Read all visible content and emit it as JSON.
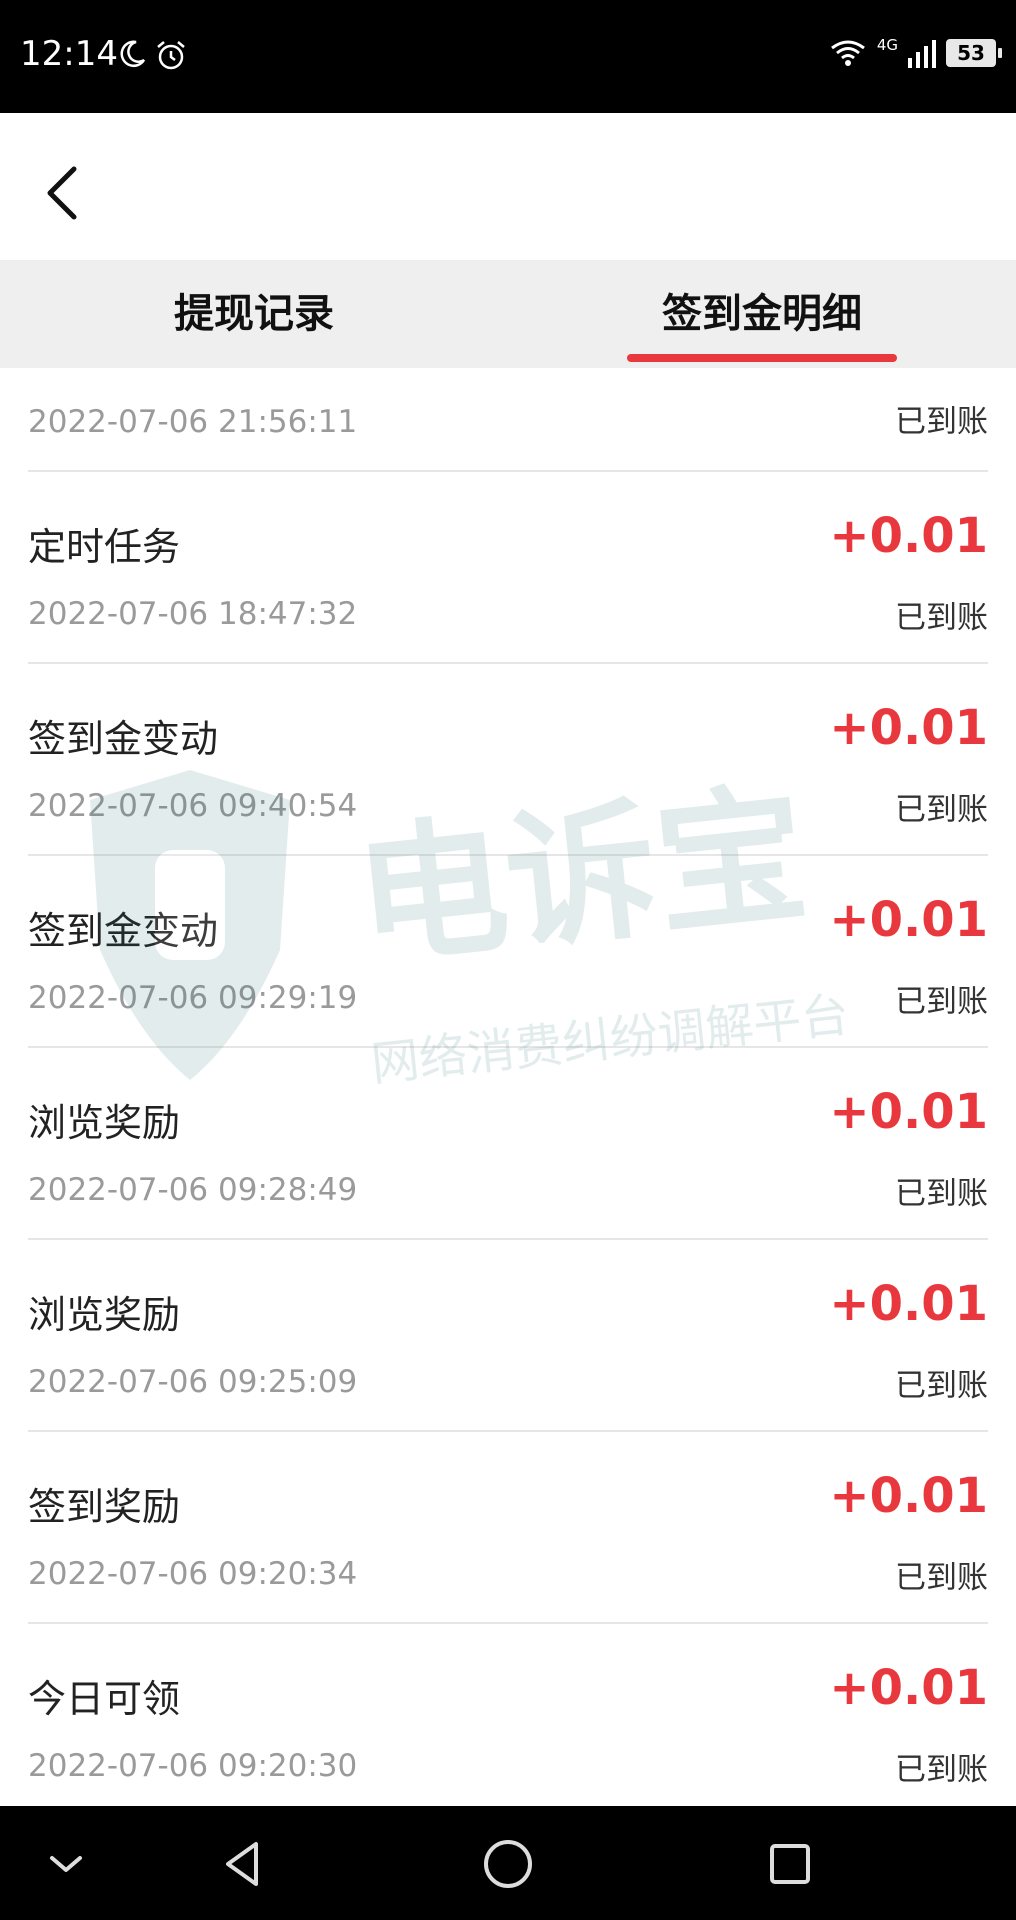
{
  "status_bar": {
    "time": "12:14",
    "battery": "53",
    "network": "4G"
  },
  "tabs": [
    {
      "label": "提现记录",
      "active": false
    },
    {
      "label": "签到金明细",
      "active": true
    }
  ],
  "accent_color": "#e8383d",
  "records": [
    {
      "title": "",
      "time": "2022-07-06 21:56:11",
      "amount": "",
      "status": "已到账"
    },
    {
      "title": "定时任务",
      "time": "2022-07-06 18:47:32",
      "amount": "+0.01",
      "status": "已到账"
    },
    {
      "title": "签到金变动",
      "time": "2022-07-06 09:40:54",
      "amount": "+0.01",
      "status": "已到账"
    },
    {
      "title": "签到金变动",
      "time": "2022-07-06 09:29:19",
      "amount": "+0.01",
      "status": "已到账"
    },
    {
      "title": "浏览奖励",
      "time": "2022-07-06 09:28:49",
      "amount": "+0.01",
      "status": "已到账"
    },
    {
      "title": "浏览奖励",
      "time": "2022-07-06 09:25:09",
      "amount": "+0.01",
      "status": "已到账"
    },
    {
      "title": "签到奖励",
      "time": "2022-07-06 09:20:34",
      "amount": "+0.01",
      "status": "已到账"
    },
    {
      "title": "今日可领",
      "time": "2022-07-06 09:20:30",
      "amount": "+0.01",
      "status": "已到账"
    }
  ],
  "watermark": {
    "title": "电诉宝",
    "subtitle": "网络消费纠纷调解平台"
  }
}
